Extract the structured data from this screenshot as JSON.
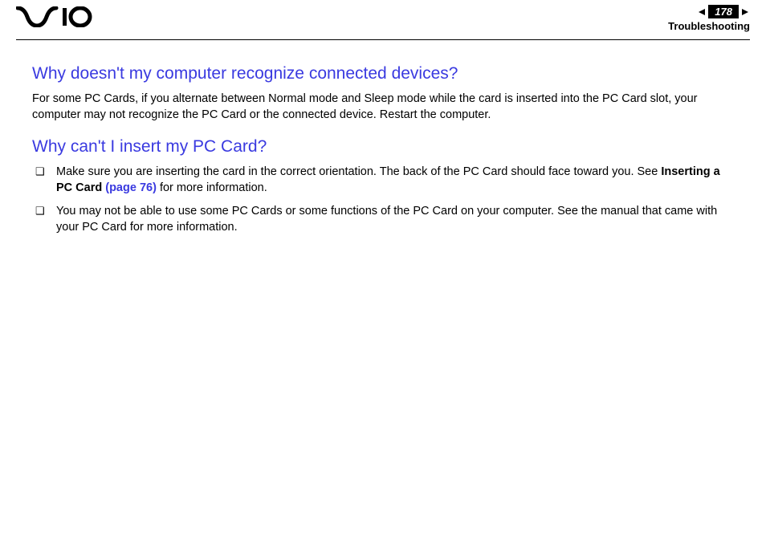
{
  "header": {
    "page_number": "178",
    "section": "Troubleshooting"
  },
  "content": {
    "q1": {
      "heading": "Why doesn't my computer recognize connected devices?",
      "body": "For some PC Cards, if you alternate between Normal mode and Sleep mode while the card is inserted into the PC Card slot, your computer may not recognize the PC Card or the connected device. Restart the computer."
    },
    "q2": {
      "heading": "Why can't I insert my PC Card?",
      "bullets": [
        {
          "pre": "Make sure you are inserting the card in the correct orientation. The back of the PC Card should face toward you. See ",
          "bold": "Inserting a PC Card ",
          "link": "(page 76)",
          "post": " for more information."
        },
        {
          "pre": "You may not be able to use some PC Cards or some functions of the PC Card on your computer. See the manual that came with your PC Card for more information.",
          "bold": "",
          "link": "",
          "post": ""
        }
      ]
    }
  }
}
